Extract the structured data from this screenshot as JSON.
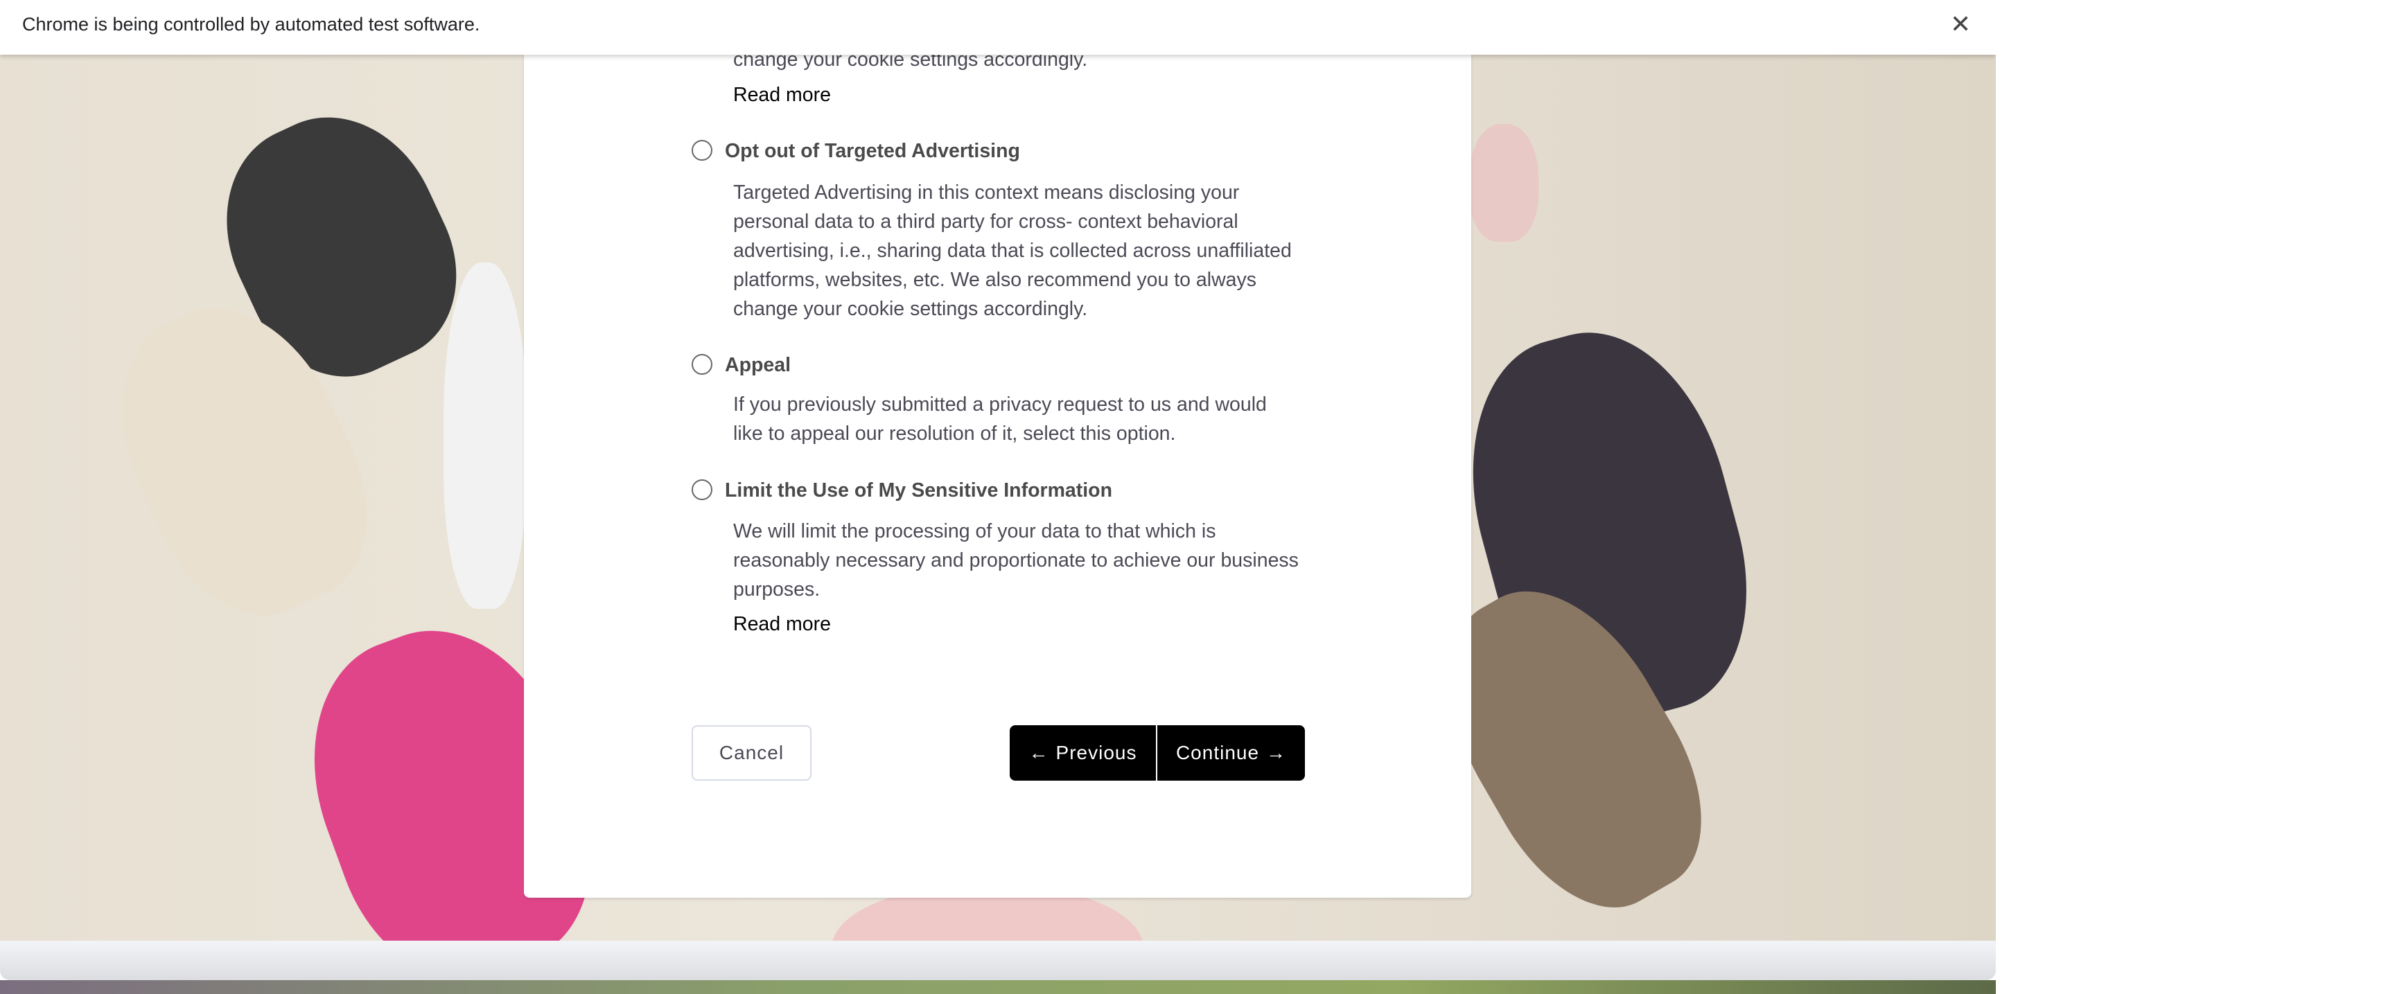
{
  "infobar": {
    "message": "Chrome is being controlled by automated test software.",
    "close_icon": "close-icon"
  },
  "modal": {
    "top_fragment": "change your cookie settings accordingly.",
    "read_more_1": "Read more",
    "options": [
      {
        "label": "Opt out of Targeted Advertising",
        "selected": false,
        "lines": [
          "Targeted Advertising in this context means disclosing your",
          "personal data to a third party for cross- context behavioral",
          "advertising, i.e., sharing data that is collected across unaffiliated",
          "platforms, websites, etc. We also recommend you to always",
          "change your cookie settings accordingly."
        ]
      },
      {
        "label": "Appeal",
        "selected": false,
        "lines": [
          "If you previously submitted a privacy request to us and would",
          "like to appeal our resolution of it, select this option."
        ]
      },
      {
        "label": "Limit the Use of My Sensitive Information",
        "selected": false,
        "lines": [
          "We will limit the processing of your data to that which is",
          "reasonably necessary and proportionate to achieve our business",
          "purposes."
        ],
        "read_more": "Read more"
      }
    ],
    "buttons": {
      "cancel": "Cancel",
      "previous": "Previous",
      "continue": "Continue"
    }
  },
  "colors": {
    "primary_button": "#000000",
    "text": "#4a4a55"
  }
}
